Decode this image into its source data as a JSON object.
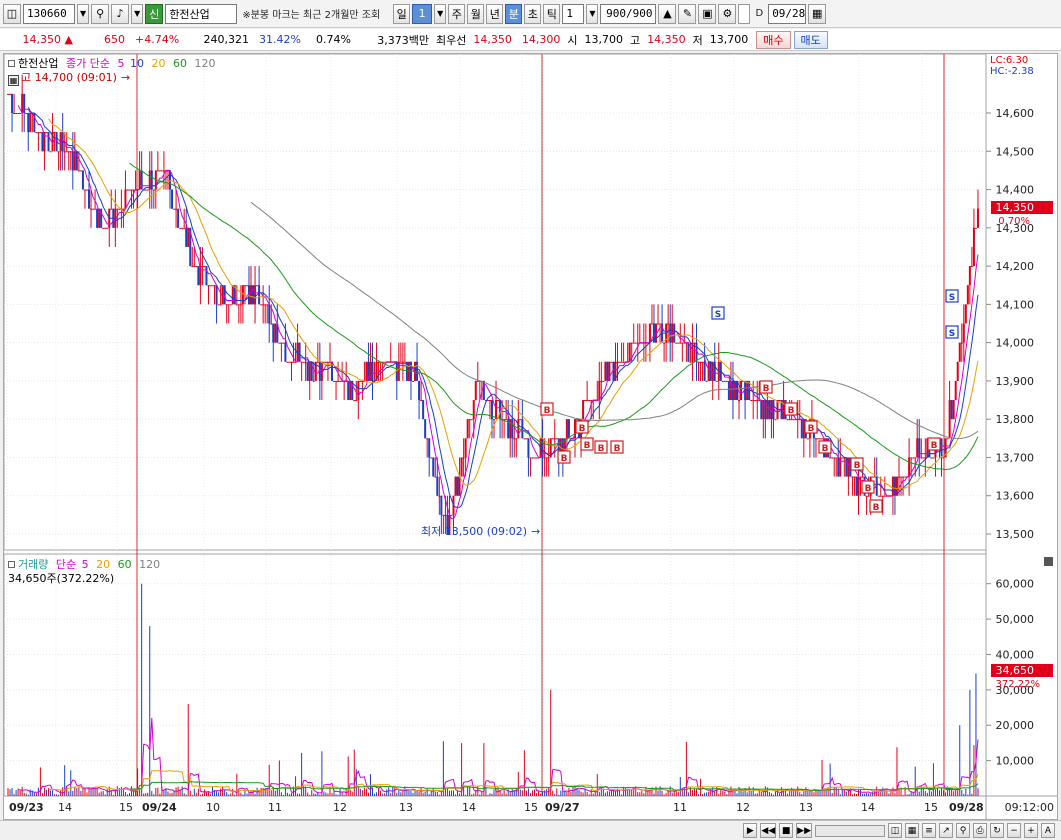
{
  "toolbar": {
    "code": "130660",
    "badge": "신",
    "name": "한전산업",
    "notice": "※분봉 마크는 최근 2개월만 조회",
    "periods": [
      "일",
      "주",
      "월",
      "년",
      "분",
      "초",
      "틱"
    ],
    "active_period": "분",
    "period_value": "1",
    "interval": "1",
    "count": "900/900",
    "date_checkbox_label": "D",
    "date": "09/28",
    "icons": [
      "panel-icon",
      "search-icon",
      "sound-icon",
      "candle-icon",
      "draw-icon",
      "save-icon",
      "gear-icon",
      "calendar-icon"
    ]
  },
  "quote": {
    "price": "14,350",
    "arrow": "▲",
    "change": "650",
    "change_pct": "+4.74%",
    "volume": "240,321",
    "vol_ratio": "31.42%",
    "turnover": "0.74%",
    "amount": "3,373백만",
    "best_ask_label": "최우선",
    "best_ask": "14,350",
    "best_bid": "14,300",
    "open_label": "시",
    "open": "13,700",
    "high_label": "고",
    "high": "14,350",
    "low_label": "저",
    "low": "13,700",
    "buy": "매수",
    "sell": "매도"
  },
  "price_panel": {
    "legend_name": "한전산업",
    "legend_type": "종가 단순",
    "ma_labels": [
      "5",
      "10",
      "20",
      "60",
      "120"
    ],
    "ma_colors": [
      "#d400d4",
      "#1a3fc4",
      "#e8a000",
      "#1a9a1a",
      "#808080"
    ],
    "high_annotation": "고 14,700 (09:01)",
    "low_annotation": "최저 13,500 (09:02)",
    "lc_label": "LC:6.30",
    "hc_label": "HC:-2.38",
    "current_price_tag": "14,350",
    "current_pct_tag": "0.70%",
    "y_ticks": [
      "14,600",
      "14,500",
      "14,400",
      "14,300",
      "14,200",
      "14,100",
      "14,000",
      "13,900",
      "13,800",
      "13,700",
      "13,600",
      "13,500"
    ]
  },
  "volume_panel": {
    "legend_name": "거래량",
    "legend_type": "단순",
    "ma_labels": [
      "5",
      "20",
      "60",
      "120"
    ],
    "info": "34,650주(372.22%)",
    "current_tag": "34,650",
    "current_pct_tag": "372.22%",
    "y_ticks": [
      "60,000",
      "50,000",
      "40,000",
      "30,000",
      "20,000",
      "10,000"
    ]
  },
  "x_axis": {
    "labels": [
      "09/23",
      "14",
      "15",
      "09/24",
      "10",
      "11",
      "12",
      "13",
      "14",
      "15",
      "09/27",
      "11",
      "12",
      "13",
      "14",
      "15",
      "09/28"
    ],
    "time_readout": "09:12:00"
  },
  "chart_data": {
    "type": "candlestick",
    "title": "",
    "ylim_price": [
      13450,
      14700
    ],
    "ylim_volume": [
      0,
      65000
    ],
    "series": [
      {
        "name": "한전산업",
        "approx_close_path": [
          14650,
          14550,
          14500,
          14300,
          14400,
          14450,
          14200,
          14100,
          14150,
          13950,
          13950,
          13850,
          13960,
          13930,
          13500,
          13900,
          13780,
          13700,
          13760,
          13900,
          14000,
          14050,
          13950,
          13900,
          13850,
          13800,
          13750,
          13650,
          13600,
          13700,
          13750,
          14350
        ]
      },
      {
        "name": "거래량",
        "peak_values": [
          60000,
          48000,
          30000,
          34650
        ]
      }
    ]
  },
  "markers": {
    "buy_label": "B",
    "sell_label": "S"
  }
}
